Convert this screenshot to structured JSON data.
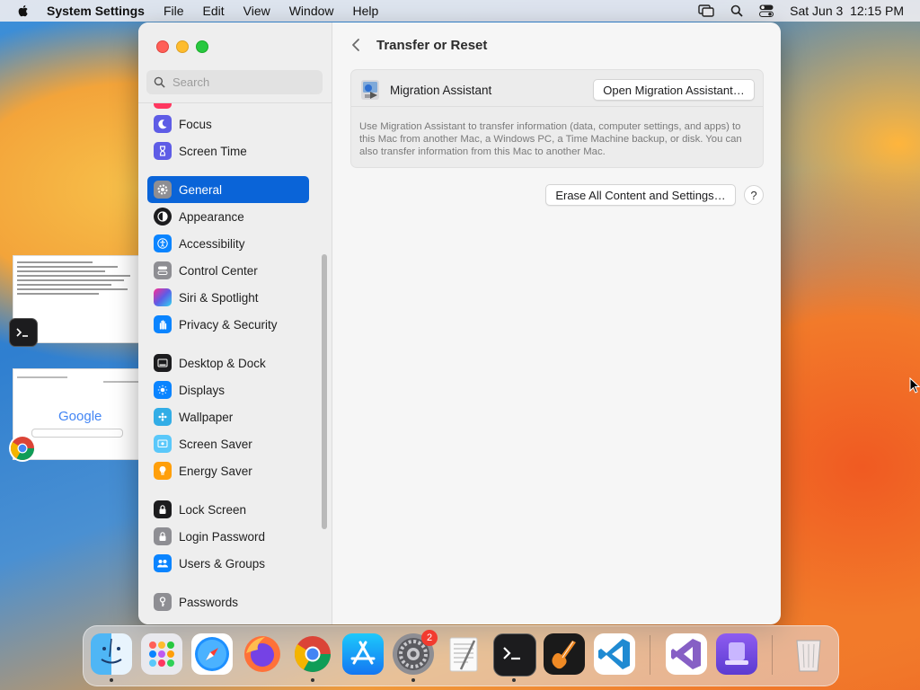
{
  "menubar": {
    "apple_icon": "apple-logo-icon",
    "app_name": "System Settings",
    "menus": [
      "File",
      "Edit",
      "View",
      "Window",
      "Help"
    ],
    "status_icons": [
      "screen-mirroring-icon",
      "spotlight-search-icon",
      "control-center-icon"
    ],
    "clock": "Sat Jun 3  12:15 PM"
  },
  "sidebar": {
    "search_placeholder": "Search",
    "items": [
      {
        "label": "Focus",
        "icon": "focus-icon",
        "color": "#5e5ce6"
      },
      {
        "label": "Screen Time",
        "icon": "screen-time-icon",
        "color": "#5e5ce6"
      },
      {
        "label": "General",
        "icon": "gear-icon",
        "color": "#8e8e93",
        "selected": true
      },
      {
        "label": "Appearance",
        "icon": "appearance-icon",
        "color": "#1c1c1e"
      },
      {
        "label": "Accessibility",
        "icon": "accessibility-icon",
        "color": "#0a84ff"
      },
      {
        "label": "Control Center",
        "icon": "control-center-icon",
        "color": "#8e8e93"
      },
      {
        "label": "Siri & Spotlight",
        "icon": "siri-icon",
        "color": "#bf5af2"
      },
      {
        "label": "Privacy & Security",
        "icon": "hand-icon",
        "color": "#0a84ff"
      },
      {
        "label": "Desktop & Dock",
        "icon": "desktop-dock-icon",
        "color": "#1c1c1e"
      },
      {
        "label": "Displays",
        "icon": "displays-icon",
        "color": "#0a84ff"
      },
      {
        "label": "Wallpaper",
        "icon": "wallpaper-icon",
        "color": "#32ade6"
      },
      {
        "label": "Screen Saver",
        "icon": "screen-saver-icon",
        "color": "#5ac8fa"
      },
      {
        "label": "Energy Saver",
        "icon": "energy-saver-icon",
        "color": "#ff9f0a"
      },
      {
        "label": "Lock Screen",
        "icon": "lock-icon",
        "color": "#1c1c1e"
      },
      {
        "label": "Login Password",
        "icon": "login-lock-icon",
        "color": "#8e8e93"
      },
      {
        "label": "Users & Groups",
        "icon": "users-icon",
        "color": "#0a84ff"
      },
      {
        "label": "Passwords",
        "icon": "key-icon",
        "color": "#8e8e93"
      }
    ]
  },
  "main": {
    "back_icon": "chevron-left-icon",
    "title": "Transfer or Reset",
    "migration": {
      "icon": "migration-assistant-icon",
      "label": "Migration Assistant",
      "button": "Open Migration Assistant…",
      "description": "Use Migration Assistant to transfer information (data, computer settings, and apps) to this Mac from another Mac, a Windows PC, a Time Machine backup, or disk. You can also transfer information from this Mac to another Mac."
    },
    "erase_button": "Erase All Content and Settings…",
    "help_button": "?"
  },
  "desktop_thumbnails": [
    {
      "app": "terminal-icon"
    },
    {
      "app": "chrome-icon",
      "page_text": "Google"
    }
  ],
  "dock": {
    "apps": [
      "Finder",
      "Launchpad",
      "Safari",
      "Firefox",
      "Google Chrome",
      "App Store",
      "System Settings",
      "TextEdit",
      "Terminal",
      "GarageBand",
      "Visual Studio Code",
      "Visual Studio",
      "Apple Configurator",
      "Trash"
    ],
    "settings_badge": "2"
  }
}
